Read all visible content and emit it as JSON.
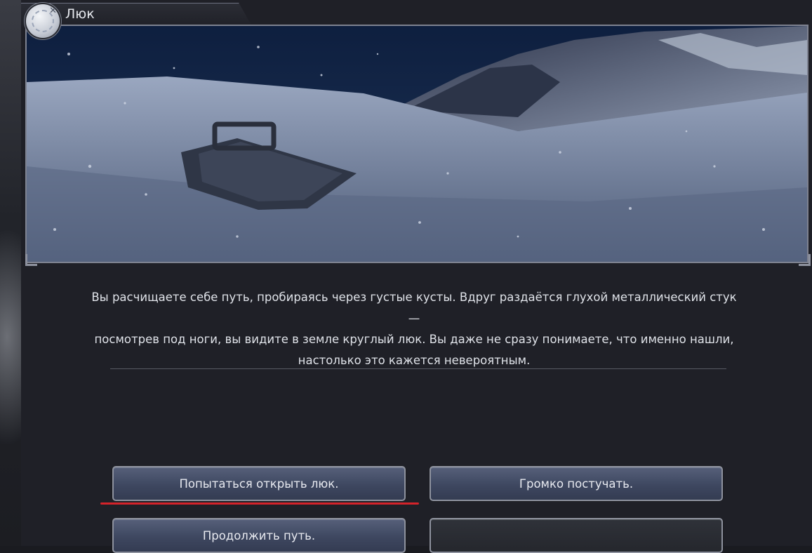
{
  "event": {
    "title": "Люк",
    "close_icon": "close-orb-icon",
    "scene_image": "snow-hatch-scene",
    "text_lines": [
      "Вы расчищаете себе путь, пробираясь через густые кусты. Вдруг раздаётся глухой металлический стук —",
      "посмотрев под ноги, вы видите в земле круглый люк. Вы даже не сразу понимаете, что именно нашли,",
      "настолько это кажется невероятным."
    ]
  },
  "choices": [
    {
      "label": "Попытаться открыть люк."
    },
    {
      "label": "Громко постучать."
    },
    {
      "label": "Продолжить путь."
    },
    {
      "label": ""
    }
  ],
  "colors": {
    "panel": "#1f2027",
    "button": "#3e4760",
    "highlight": "#d4232a"
  }
}
